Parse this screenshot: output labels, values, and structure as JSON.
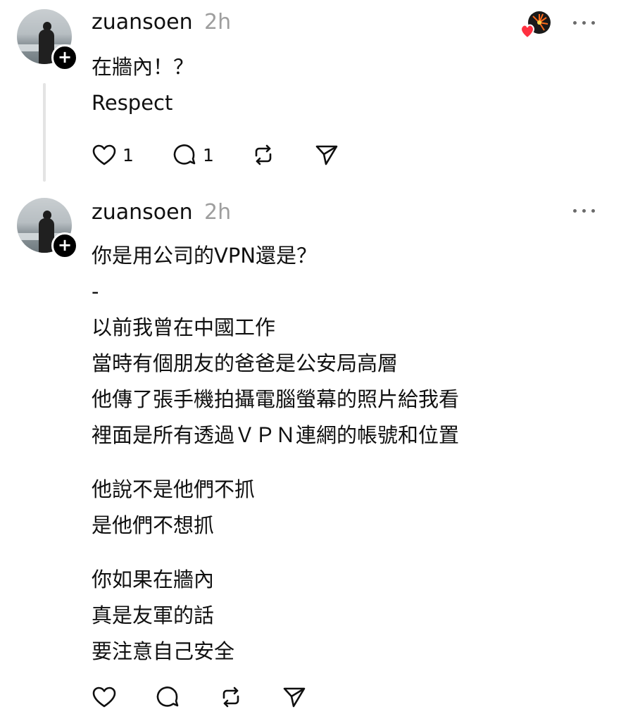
{
  "posts": [
    {
      "username": "zuansoen",
      "time": "2h",
      "lines": [
        "在牆內！？",
        "Respect"
      ],
      "likes": "1",
      "replies": "1",
      "avatar_icon": "profile-photo",
      "has_reaction_badge": true
    },
    {
      "username": "zuansoen",
      "time": "2h",
      "paragraphs": [
        [
          "你是用公司的VPN還是？",
          "-",
          "以前我曾在中國工作",
          "當時有個朋友的爸爸是公安局高層",
          "他傳了張手機拍攝電腦螢幕的照片給我看",
          "裡面是所有透過ＶＰＮ連網的帳號和位置"
        ],
        [
          "他說不是他們不抓",
          "是他們不想抓"
        ],
        [
          "你如果在牆內",
          "真是友軍的話",
          "要注意自己安全"
        ]
      ],
      "avatar_icon": "profile-photo"
    }
  ],
  "icons": {
    "like": "heart-icon",
    "reply": "comment-bubble-icon",
    "repost": "repost-icon",
    "share": "send-icon",
    "more": "more-dots-icon",
    "follow": "plus-icon"
  },
  "colors": {
    "text": "#101010",
    "muted": "#9e9e9e",
    "thread_line": "#e4e4e4",
    "heart": "#ff3040"
  }
}
